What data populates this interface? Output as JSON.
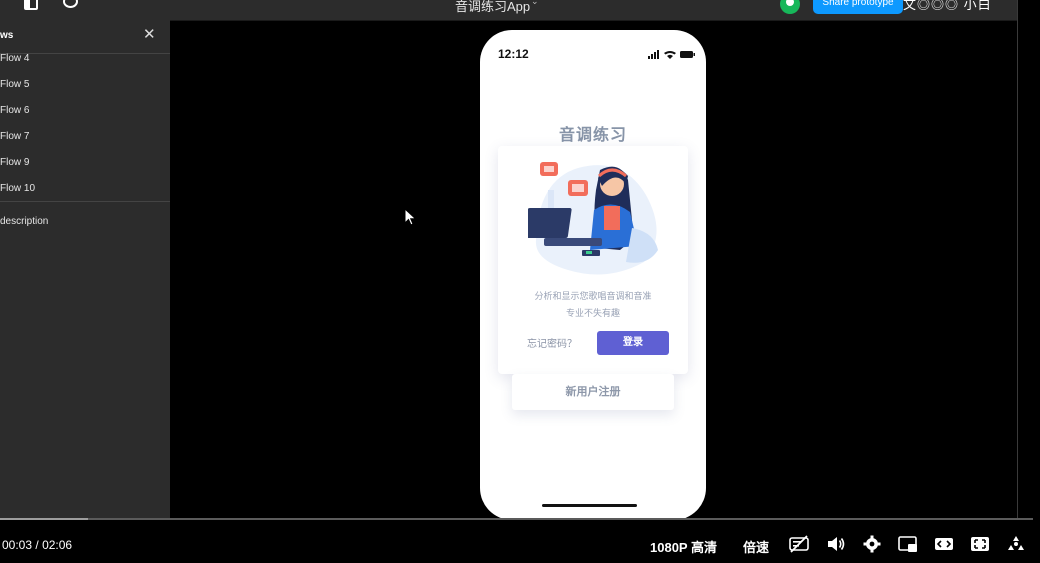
{
  "topbar": {
    "title": "音调练习App",
    "chevron": "⌄",
    "share_label": "Share prototype",
    "overlay_text": "文◎◎◎ 小白"
  },
  "sidebar": {
    "header_title": "ws",
    "close": "✕",
    "flows": [
      "Flow 4",
      "Flow 5",
      "Flow 6",
      "Flow 7",
      "Flow 9",
      "Flow 10"
    ],
    "description": "description"
  },
  "phone": {
    "time": "12:12",
    "heading": "音调练习",
    "tagline_1": "分析和显示您歌唱音调和音准",
    "tagline_2": "专业不失有趣",
    "forgot": "忘记密码？",
    "login": "登录",
    "register": "新用户注册"
  },
  "player": {
    "current_time": "00:03",
    "separator": "/",
    "duration": "02:06",
    "progress_fraction": 0.085,
    "quality": "1080P 高清",
    "speed": "倍速"
  },
  "colors": {
    "accent_blue": "#0d99ff",
    "login_purple": "#5f60d3",
    "heading_gray": "#8794a8"
  }
}
